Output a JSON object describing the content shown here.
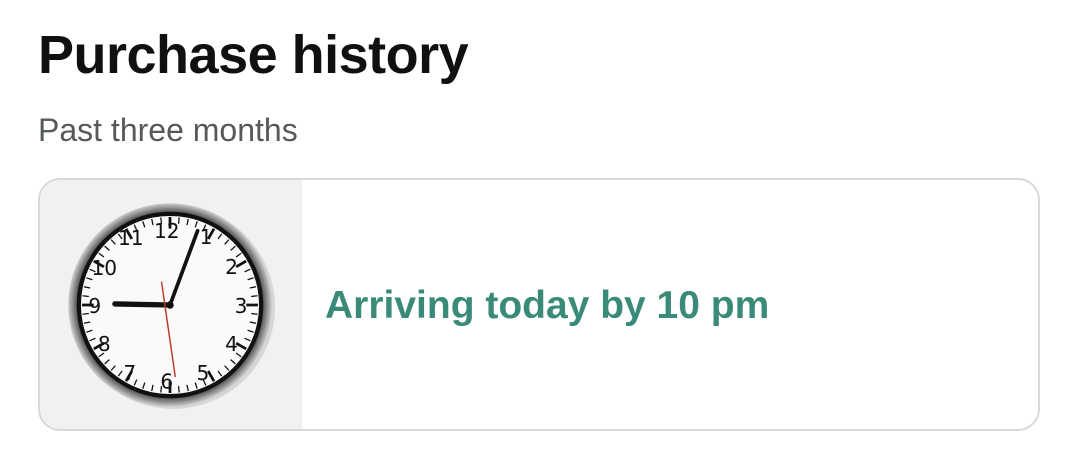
{
  "header": {
    "title": "Purchase history",
    "subtitle": "Past three months"
  },
  "order": {
    "status_text": "Arriving today by 10 pm",
    "status_color": "#3a8a7a",
    "thumbnail_icon": "wall-clock-icon"
  }
}
